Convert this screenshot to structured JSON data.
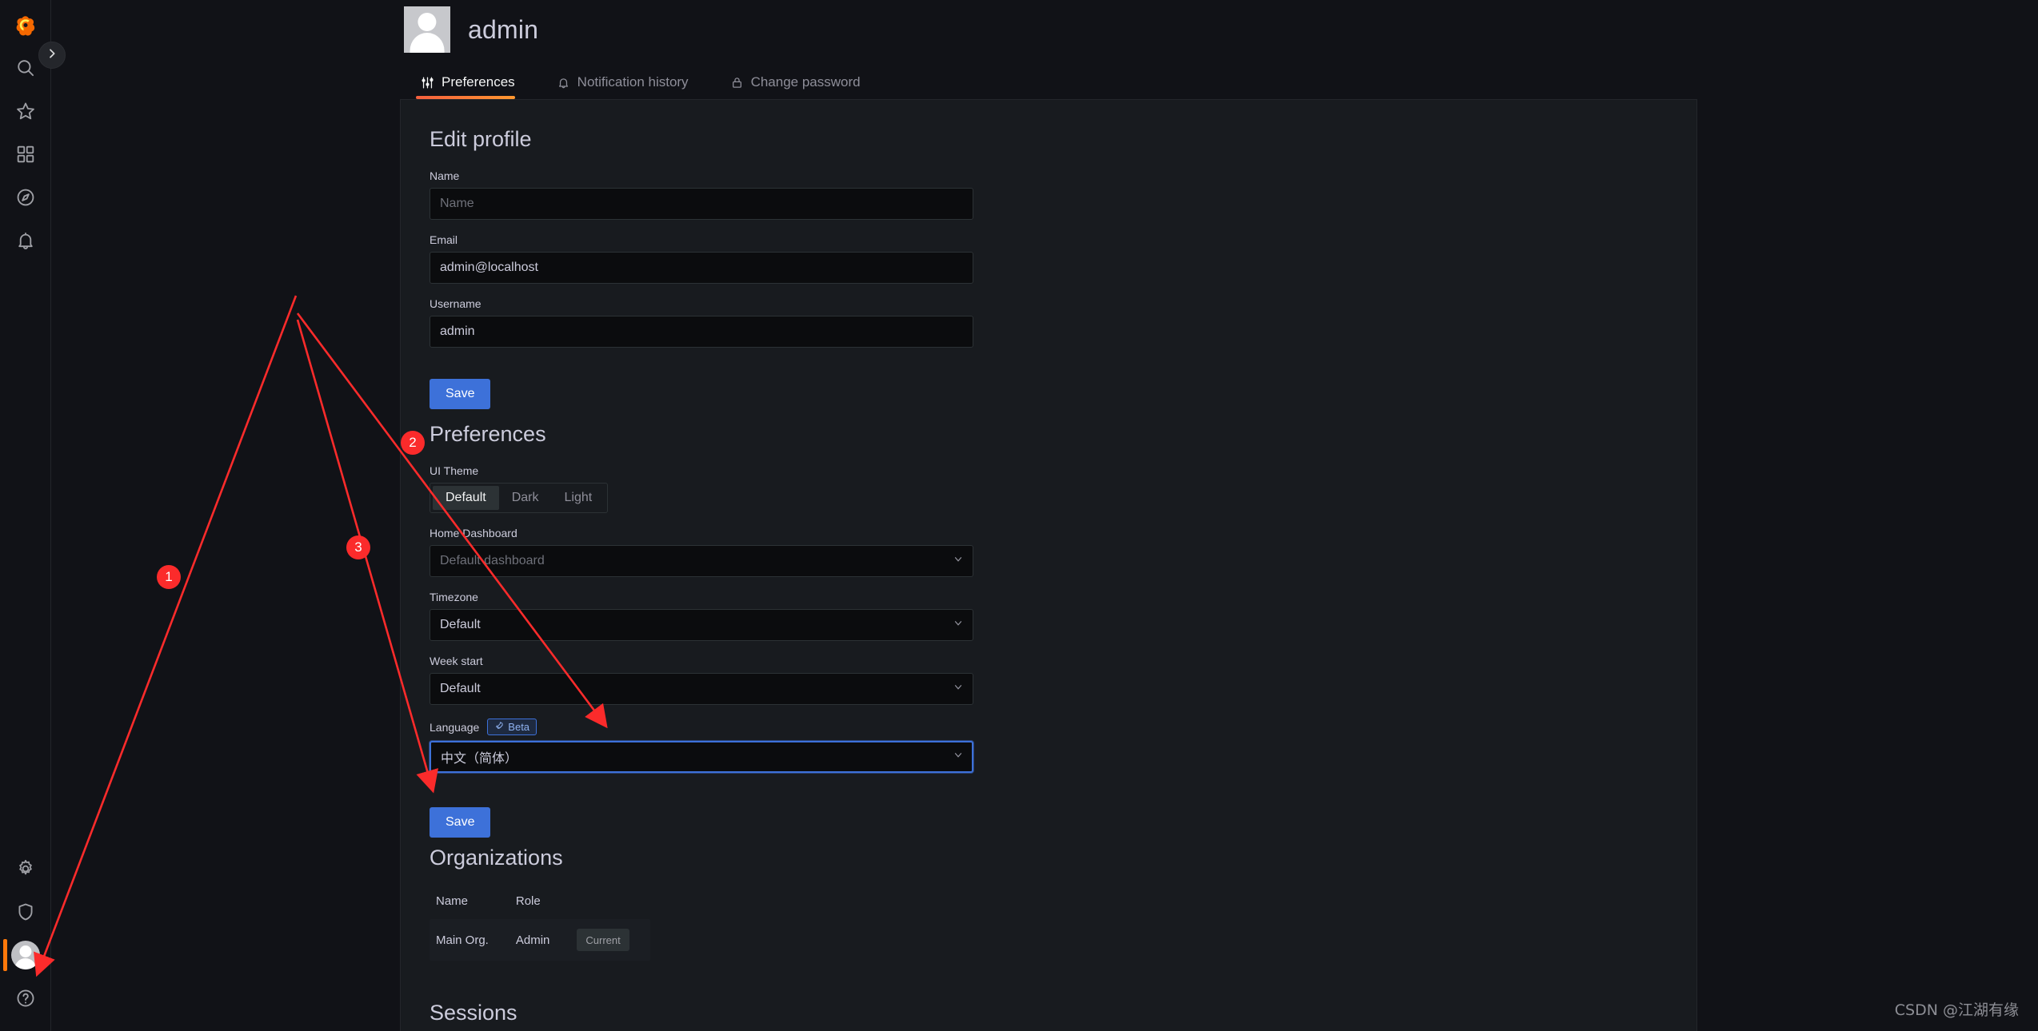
{
  "sidebar": {
    "logo_label": "Grafana",
    "expand_label": "Expand menu",
    "items": [
      {
        "name": "search",
        "label": "Search"
      },
      {
        "name": "starred",
        "label": "Starred"
      },
      {
        "name": "dashboards",
        "label": "Dashboards"
      },
      {
        "name": "explore",
        "label": "Explore"
      },
      {
        "name": "alerting",
        "label": "Alerting"
      }
    ],
    "bottom_items": [
      {
        "name": "configuration",
        "label": "Configuration"
      },
      {
        "name": "server-admin",
        "label": "Server Admin"
      },
      {
        "name": "profile",
        "label": "admin",
        "active": true
      },
      {
        "name": "help",
        "label": "Help"
      }
    ]
  },
  "header": {
    "title": "admin"
  },
  "tabs": [
    {
      "label": "Preferences",
      "icon": "sliders-icon",
      "active": true
    },
    {
      "label": "Notification history",
      "icon": "bell-icon",
      "active": false
    },
    {
      "label": "Change password",
      "icon": "lock-icon",
      "active": false
    }
  ],
  "edit_profile": {
    "title": "Edit profile",
    "name_label": "Name",
    "name_value": "",
    "name_placeholder": "Name",
    "email_label": "Email",
    "email_value": "admin@localhost",
    "username_label": "Username",
    "username_value": "admin",
    "save_label": "Save"
  },
  "preferences": {
    "title": "Preferences",
    "ui_theme_label": "UI Theme",
    "ui_theme_options": [
      "Default",
      "Dark",
      "Light"
    ],
    "ui_theme_selected": "Default",
    "home_dashboard_label": "Home Dashboard",
    "home_dashboard_value": "Default dashboard",
    "timezone_label": "Timezone",
    "timezone_value": "Default",
    "week_start_label": "Week start",
    "week_start_value": "Default",
    "language_label": "Language",
    "language_badge": "Beta",
    "language_value": "中文（简体）",
    "save_label": "Save"
  },
  "organizations": {
    "title": "Organizations",
    "columns": [
      "Name",
      "Role"
    ],
    "rows": [
      {
        "name": "Main Org.",
        "role": "Admin",
        "action": "Current"
      }
    ]
  },
  "sessions": {
    "title": "Sessions"
  },
  "annotations": {
    "markers": [
      "1",
      "2",
      "3"
    ],
    "arrow_color": "#fb2b2b"
  },
  "watermark": "CSDN @江湖有缘",
  "colors": {
    "accent": "#ff780a",
    "primary_button": "#3d71d9",
    "focus_ring": "#3d71d9",
    "page_bg": "#111217",
    "panel_bg": "#181b1f",
    "input_bg": "#0b0c0e",
    "text": "#ccccdc",
    "text_muted": "#8e8e99"
  }
}
